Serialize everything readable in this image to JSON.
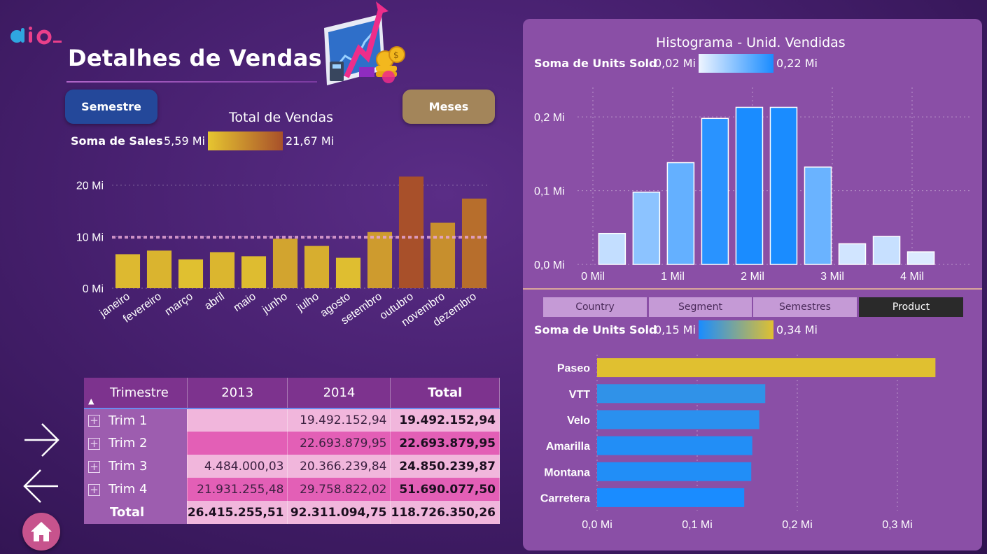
{
  "header": {
    "title": "Detalhes de Vendas"
  },
  "buttons": {
    "semestre": "Semestre",
    "meses": "Meses"
  },
  "sales_chart": {
    "title": "Total de Vendas",
    "legend_label": "Soma de  Sales",
    "legend_min": "5,59 Mi",
    "legend_max": "21,67 Mi"
  },
  "histogram": {
    "title": "Histograma - Unid. Vendidas",
    "legend_label": "Soma de Units Sold",
    "legend_min": "0,02 Mi",
    "legend_max": "0,22 Mi"
  },
  "product_chart": {
    "legend_label": "Soma de Units Sold",
    "legend_min": "0,15 Mi",
    "legend_max": "0,34 Mi"
  },
  "tabs": [
    {
      "label": "Country",
      "active": false
    },
    {
      "label": "Segment",
      "active": false
    },
    {
      "label": "Semestres",
      "active": false
    },
    {
      "label": "Product",
      "active": true
    }
  ],
  "colors": {
    "accent_gold": "#e0c030",
    "accent_rust": "#a8502a",
    "bar_blue": "#1a8cff",
    "bar_light": "#dceaff",
    "product_gold": "#e0c030"
  },
  "table": {
    "headers": [
      "Trimestre",
      "2013",
      "2014",
      "Total"
    ],
    "rows": [
      {
        "label": "Trim 1",
        "y2013": "",
        "y2014": "19.492.152,94",
        "total": "19.492.152,94"
      },
      {
        "label": "Trim 2",
        "y2013": "",
        "y2014": "22.693.879,95",
        "total": "22.693.879,95"
      },
      {
        "label": "Trim 3",
        "y2013": "4.484.000,03",
        "y2014": "20.366.239,84",
        "total": "24.850.239,87"
      },
      {
        "label": "Trim 4",
        "y2013": "21.931.255,48",
        "y2014": "29.758.822,02",
        "total": "51.690.077,50"
      }
    ],
    "total_row": {
      "label": "Total",
      "y2013": "26.415.255,51",
      "y2014": "92.311.094,75",
      "total": "118.726.350,26"
    }
  },
  "chart_data": [
    {
      "type": "bar",
      "title": "Total de Vendas",
      "categories": [
        "janeiro",
        "fevereiro",
        "março",
        "abril",
        "maio",
        "junho",
        "julho",
        "agosto",
        "setembro",
        "outubro",
        "novembro",
        "dezembro"
      ],
      "values": [
        6.6,
        7.3,
        5.6,
        7.0,
        6.2,
        9.6,
        8.2,
        5.9,
        10.9,
        21.67,
        12.7,
        17.4
      ],
      "ylim": [
        0,
        22
      ],
      "yticks": [
        "0 Mi",
        "10 Mi",
        "20 Mi"
      ],
      "ytick_values": [
        0,
        10,
        20
      ],
      "average_line": 9.9,
      "grid": true
    },
    {
      "type": "bar",
      "title": "Histograma - Unid. Vendidas",
      "x_ticks": [
        "0 Mil",
        "1 Mil",
        "2 Mil",
        "3 Mil",
        "4 Mil"
      ],
      "x_tick_values": [
        0,
        1,
        2,
        3,
        4
      ],
      "bin_centers": [
        0.24,
        0.67,
        1.1,
        1.53,
        1.96,
        2.39,
        2.82,
        3.25,
        3.68,
        4.11
      ],
      "values": [
        0.042,
        0.098,
        0.138,
        0.198,
        0.213,
        0.213,
        0.132,
        0.028,
        0.038,
        0.017
      ],
      "ylim": [
        0,
        0.24
      ],
      "yticks": [
        "0,0 Mi",
        "0,1 Mi",
        "0,2 Mi"
      ],
      "ytick_values": [
        0,
        0.1,
        0.2
      ],
      "grid": true
    },
    {
      "type": "bar",
      "orientation": "horizontal",
      "categories": [
        "Paseo",
        "VTT",
        "Velo",
        "Amarilla",
        "Montana",
        "Carretera"
      ],
      "values": [
        0.338,
        0.168,
        0.162,
        0.155,
        0.154,
        0.147
      ],
      "xlim": [
        0,
        0.35
      ],
      "xticks": [
        "0,0 Mi",
        "0,1 Mi",
        "0,2 Mi",
        "0,3 Mi"
      ],
      "xtick_values": [
        0,
        0.1,
        0.2,
        0.3
      ],
      "grid": true
    }
  ]
}
